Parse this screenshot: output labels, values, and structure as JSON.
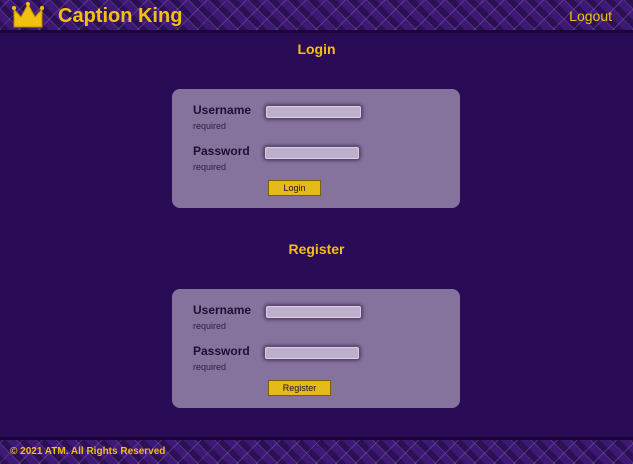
{
  "header": {
    "brand": "Caption King",
    "logout_label": "Logout",
    "logo_icon": "crown-icon",
    "accent_color": "#f2c00f"
  },
  "login": {
    "title": "Login",
    "username_label": "Username",
    "username_hint": "required",
    "username_value": "",
    "password_label": "Password",
    "password_hint": "required",
    "password_value": "",
    "button_label": "Login"
  },
  "register": {
    "title": "Register",
    "username_label": "Username",
    "username_hint": "required",
    "username_value": "",
    "password_label": "Password",
    "password_hint": "required",
    "password_value": "",
    "button_label": "Register"
  },
  "footer": {
    "copyright": "© 2021 ATM. All Rights Reserved"
  }
}
